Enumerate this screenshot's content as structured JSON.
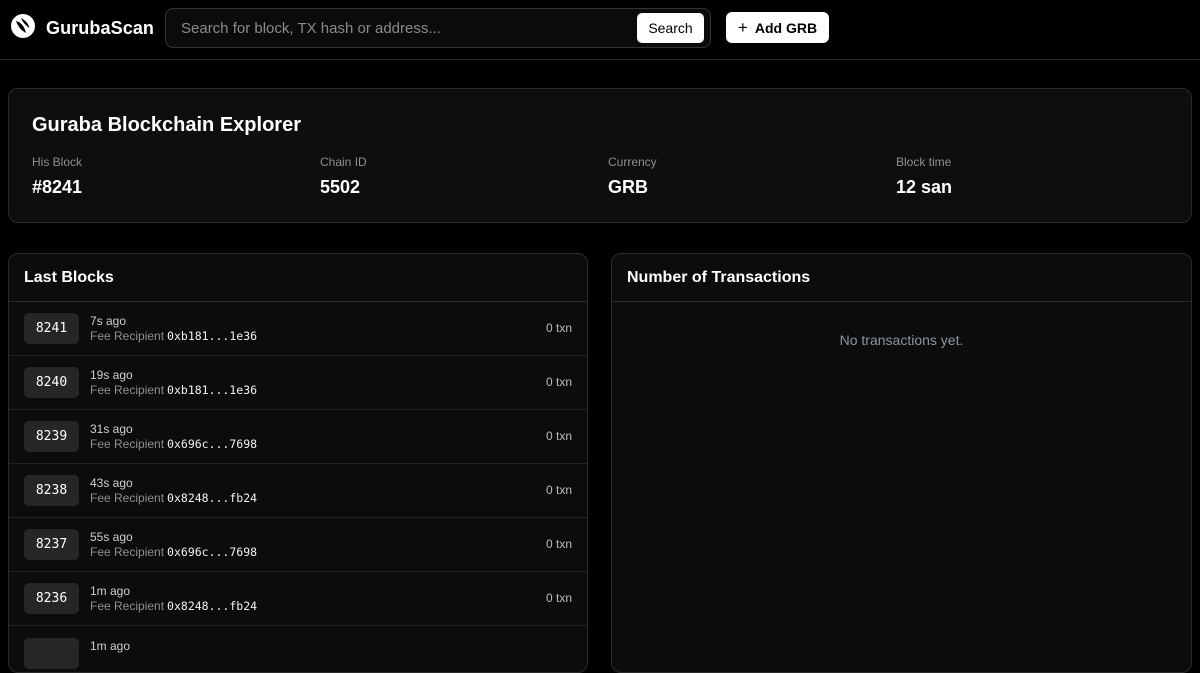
{
  "header": {
    "brand": "GurubaScan",
    "search_placeholder": "Search for block, TX hash or address...",
    "search_button": "Search",
    "add_button": "Add GRB"
  },
  "overview": {
    "title": "Guraba Blockchain Explorer",
    "stats": [
      {
        "label": "His Block",
        "value": "#8241"
      },
      {
        "label": "Chain ID",
        "value": "5502"
      },
      {
        "label": "Currency",
        "value": "GRB"
      },
      {
        "label": "Block time",
        "value": "12 san"
      }
    ]
  },
  "blocks": {
    "title": "Last Blocks",
    "fee_label": "Fee Recipient",
    "items": [
      {
        "number": "8241",
        "ago": "7s ago",
        "recipient": "0xb181...1e36",
        "txn": "0 txn"
      },
      {
        "number": "8240",
        "ago": "19s ago",
        "recipient": "0xb181...1e36",
        "txn": "0 txn"
      },
      {
        "number": "8239",
        "ago": "31s ago",
        "recipient": "0x696c...7698",
        "txn": "0 txn"
      },
      {
        "number": "8238",
        "ago": "43s ago",
        "recipient": "0x8248...fb24",
        "txn": "0 txn"
      },
      {
        "number": "8237",
        "ago": "55s ago",
        "recipient": "0x696c...7698",
        "txn": "0 txn"
      },
      {
        "number": "8236",
        "ago": "1m ago",
        "recipient": "0x8248...fb24",
        "txn": "0 txn"
      },
      {
        "number": "",
        "ago": "1m ago",
        "recipient": "",
        "txn": ""
      }
    ]
  },
  "transactions": {
    "title": "Number of Transactions",
    "empty_message": "No transactions yet."
  }
}
